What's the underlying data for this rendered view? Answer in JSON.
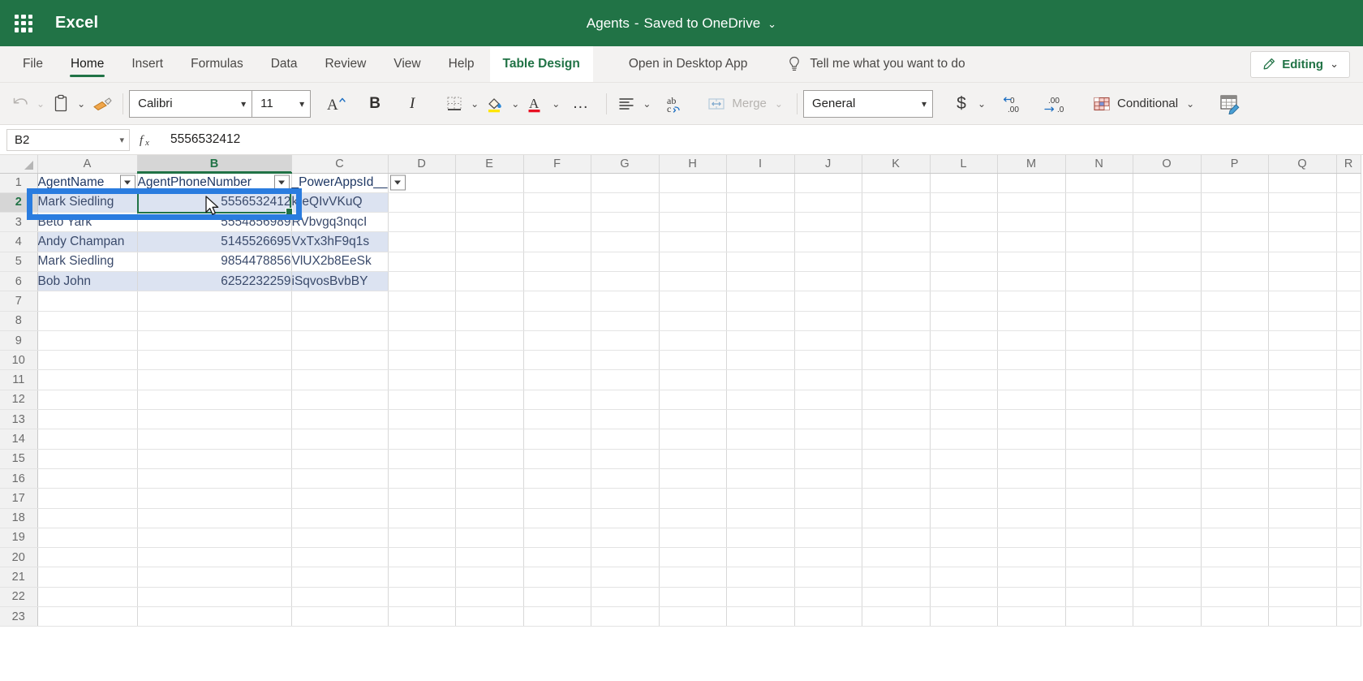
{
  "titlebar": {
    "app_label": "Excel",
    "waffle_icon": "app-launcher-icon",
    "document_name": "Agents",
    "separator": "-",
    "save_state": "Saved to OneDrive",
    "chevron": "⌄",
    "brand_color": "#217346"
  },
  "ribbon": {
    "tabs": [
      {
        "label": "File",
        "active": false
      },
      {
        "label": "Home",
        "active": true
      },
      {
        "label": "Insert",
        "active": false
      },
      {
        "label": "Formulas",
        "active": false
      },
      {
        "label": "Data",
        "active": false
      },
      {
        "label": "Review",
        "active": false
      },
      {
        "label": "View",
        "active": false
      },
      {
        "label": "Help",
        "active": false
      }
    ],
    "contextual_tab": "Table Design",
    "open_desktop": "Open in Desktop App",
    "tellme": {
      "icon": "lightbulb-icon",
      "label": "Tell me what you want to do"
    },
    "editing": {
      "icon": "pencil-icon",
      "label": "Editing",
      "chevron": "⌄"
    }
  },
  "toolbar": {
    "undo": "undo-icon",
    "undo_chevron": "⌄",
    "paste": "paste-icon",
    "paste_chevron": "⌄",
    "format_painter": "format-painter-icon",
    "font_name": "Calibri",
    "font_size": "11",
    "grow_font": "grow-font-icon",
    "bold": "B",
    "italic": "I",
    "borders": "borders-icon",
    "borders_chevron": "⌄",
    "fill_color": "fill-color-icon",
    "fill_chevron": "⌄",
    "font_color": "font-color-icon",
    "font_color_chevron": "⌄",
    "more_font": "…",
    "align": "align-left-icon",
    "align_chevron": "⌄",
    "wrap_text": "wrap-text-icon",
    "merge_icon": "merge-cells-icon",
    "merge_label": "Merge",
    "merge_chevron": "⌄",
    "number_format": "General",
    "currency": "$",
    "currency_chevron": "⌄",
    "increase_decimal": "increase-decimal-icon",
    "decrease_decimal": "decrease-decimal-icon",
    "conditional_icon": "conditional-formatting-icon",
    "conditional_label": "Conditional",
    "conditional_chevron": "⌄",
    "format_table": "format-as-table-icon",
    "fill_swatch_color": "#ffe600",
    "font_swatch_color": "#e81123"
  },
  "formula_bar": {
    "name_box": "B2",
    "name_chevron": "⌄",
    "fx": "fx",
    "formula_value": "5556532412"
  },
  "grid": {
    "columns": [
      "A",
      "B",
      "C",
      "D",
      "E",
      "F",
      "G",
      "H",
      "I",
      "J",
      "K",
      "L",
      "M",
      "N",
      "O",
      "P",
      "Q",
      "R"
    ],
    "selected_column": "B",
    "selected_row": "2",
    "rows": [
      "1",
      "2",
      "3",
      "4",
      "5",
      "6",
      "7",
      "8",
      "9",
      "10",
      "11",
      "12",
      "13",
      "14",
      "15",
      "16",
      "17",
      "18",
      "19",
      "20",
      "21",
      "22",
      "23"
    ],
    "table": {
      "header": [
        "AgentName",
        "AgentPhoneNumber",
        "_PowerAppsId__"
      ],
      "header_c_visible_left": "_Powe",
      "header_c_visible_right": "ppsId__",
      "data": [
        {
          "row": "2",
          "AgentName": "Mark Siedling",
          "AgentPhoneNumber": "5556532412",
          "PowerAppsId": "k-eQIvVKuQ"
        },
        {
          "row": "3",
          "AgentName": "Beto Yark",
          "AgentPhoneNumber": "5554856989",
          "PowerAppsId": "RVbvgq3nqcI"
        },
        {
          "row": "4",
          "AgentName": "Andy Champan",
          "AgentPhoneNumber": "5145526695",
          "PowerAppsId": "VxTx3hF9q1s"
        },
        {
          "row": "5",
          "AgentName": "Mark Siedling",
          "AgentPhoneNumber": "9854478856",
          "PowerAppsId": "VlUX2b8EeSk"
        },
        {
          "row": "6",
          "AgentName": "Bob John",
          "AgentPhoneNumber": "6252232259",
          "PowerAppsId": "iSqvosBvbBY"
        }
      ]
    },
    "active_cell": "B2",
    "annotation_color": "#2a7cdf",
    "table_band_color": "#dce3f1",
    "table_header_color": "#1f3864"
  }
}
